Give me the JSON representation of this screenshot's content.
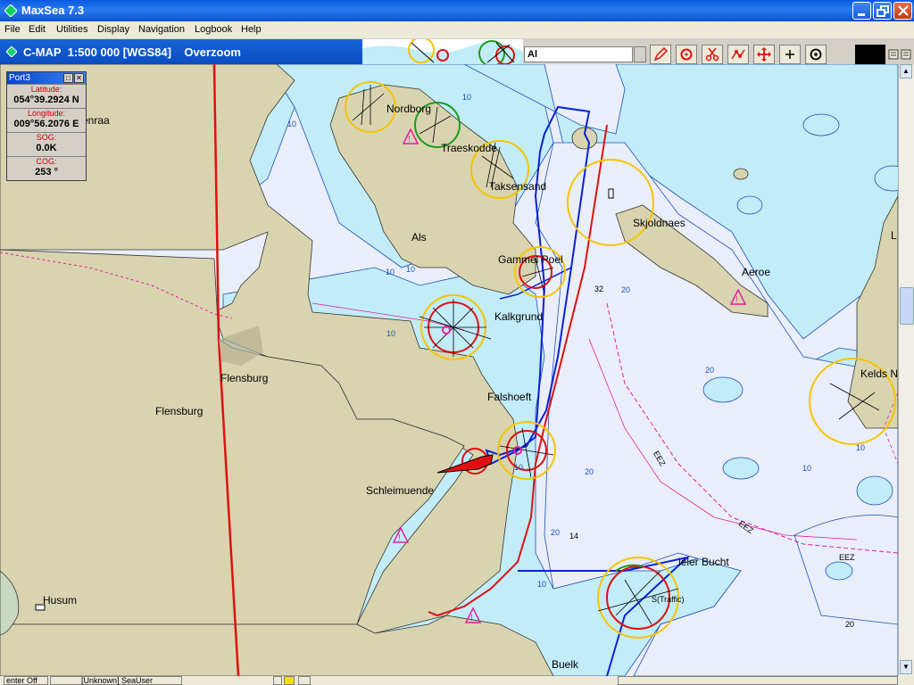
{
  "window": {
    "title": "MaxSea 7.3"
  },
  "menu": [
    "File",
    "Edit",
    "Utilities",
    "Display",
    "Navigation",
    "Logbook",
    "Help"
  ],
  "chart_window": {
    "title": "C-MAP  1:500 000 [WGS84]    Overzoom"
  },
  "toolbar": {
    "layer_field_value": "Al"
  },
  "port_panel": {
    "title": "Port3",
    "latitude_label": "Latitude:",
    "latitude_value": "054°39.2924 N",
    "longitude_label": "Longitude:",
    "longitude_value": "009°56.2076 E",
    "sog_label": "SOG:",
    "sog_value": "0.0K",
    "cog_label": "COG:",
    "cog_value": "253 °"
  },
  "map_labels": {
    "nordborg": "Nordborg",
    "traeskodde": "Traeskodde",
    "taksensand": "Taksensand",
    "als": "Als",
    "skjoldnaes": "Skjoldnaes",
    "aeroe": "Aeroe",
    "gammel_poel": "Gammel Poel",
    "kalkgrund": "Kalkgrund",
    "flensburg_port": "Flensburg",
    "flensburg_town": "Flensburg",
    "falshoeft": "Falshoeft",
    "schleimuende": "Schleimuende",
    "kieler_bucht": "ieler Bucht",
    "husum": "Husum",
    "buelk": "Buelk",
    "keldsnor": "Kelds N",
    "aabenraa": "enraa",
    "traffic": "S(Traffic)",
    "eez_1": "EEZ",
    "eez_2": "EEZ",
    "eez_3": "EEZ",
    "l_edge": "L"
  },
  "depths": {
    "d32": "32",
    "d14": "14",
    "d20a": "20",
    "d20b": "20",
    "d20c": "20",
    "d20d": "20",
    "d10a": "10",
    "d10b": "10",
    "d10c": "10",
    "d10d": "10",
    "d10e": "10",
    "d10f": "10",
    "d10g": "10",
    "d10h": "10",
    "d10i": "10",
    "d20e": "20"
  },
  "status_bar": {
    "left": "enter Off",
    "user": "[Unknown] SeaUser"
  },
  "colors": {
    "land": "#d9d4b0",
    "shallow": "#c2ecf7",
    "deep": "#e9eefa",
    "track_blue": "#0a22d6",
    "track_red": "#e01010",
    "eez": "#e020a0",
    "sector_yellow": "#f5c400"
  }
}
